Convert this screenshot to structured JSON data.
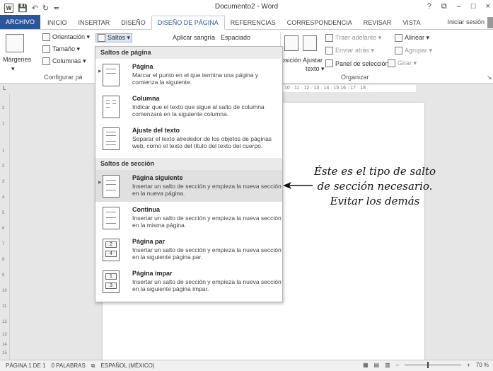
{
  "window": {
    "title": "Documento2 - Word",
    "help": "?",
    "restore_icon": "⧉",
    "minimize": "–",
    "close": "×",
    "word_icon": "W"
  },
  "qat": {
    "save": "💾",
    "undo": "↶",
    "redo": "↻",
    "more": "≖"
  },
  "tabs": [
    "ARCHIVO",
    "INICIO",
    "INSERTAR",
    "DISEÑO",
    "DISEÑO DE PÁGINA",
    "REFERENCIAS",
    "CORRESPONDENCIA",
    "REVISAR",
    "VISTA"
  ],
  "signin": "Iniciar sesión",
  "ribbon": {
    "margenes": "Márgenes",
    "orientacion": "Orientación ▾",
    "tamano": "Tamaño ▾",
    "columnas": "Columnas ▾",
    "saltos": "Saltos ▾",
    "aplicar_sangria": "Aplicar sangría",
    "espaciado": "Espaciado",
    "posicion": "osición",
    "ajustar": "Ajustar",
    "texto": "texto ▾",
    "traer_adelante": "Traer adelante ▾",
    "enviar_atras": "Enviar atrás ▾",
    "panel_seleccion": "Panel de selección",
    "alinear": "Alinear ▾",
    "agrupar": "Agrupar ▾",
    "girar": "Girar ▾",
    "grp_configurar": "Configurar pá",
    "grp_organizar": "Organizar"
  },
  "ruler": {
    "corner": "L",
    "marks": "10 · 11 · 12 · 13 · 14 · 15 16 · 17 · 18 ·",
    "vertical": [
      "2",
      "1",
      "1",
      "2",
      "3",
      "4",
      "5",
      "6",
      "7",
      "8",
      "9",
      "10",
      "11",
      "12",
      "13",
      "14",
      "15"
    ]
  },
  "dropdown": {
    "section_page": "Saltos de página",
    "section_section": "Saltos de sección",
    "items": [
      {
        "title": "Página",
        "desc": "Marcar el punto en el que termina una página y comienza la siguiente."
      },
      {
        "title": "Columna",
        "desc": "Indicar que el texto que sigue al salto de columna comenzará en la siguiente columna."
      },
      {
        "title": "Ajuste del texto",
        "desc": "Separar el texto alrededor de los objetos de páginas web, como el texto del título del texto del cuerpo."
      },
      {
        "title": "Página siguiente",
        "desc": "Insertar un salto de sección y empieza la nueva sección en la nueva página."
      },
      {
        "title": "Continua",
        "desc": "Insertar un salto de sección y empieza la nueva sección en la misma página."
      },
      {
        "title": "Página par",
        "desc": "Insertar un salto de sección y empieza la nueva sección en la siguiente página par."
      },
      {
        "title": "Página impar",
        "desc": "Insertar un salto de sección y empieza la nueva sección en la siguiente página impar."
      }
    ],
    "thumb_numbers": {
      "par_top": "2",
      "par_bottom": "4",
      "impar_top": "1",
      "impar_bottom": "3"
    }
  },
  "annotation": {
    "line1": "Éste es el tipo de salto",
    "line2": "de sección necesario.",
    "line3": "Evitar los demás"
  },
  "status": {
    "page": "PÁGINA 1 DE 1",
    "words": "0 PALABRAS",
    "lang": "ESPAÑOL (MÉXICO)",
    "zoom_minus": "–",
    "zoom_plus": "+",
    "zoom": "70 %",
    "zoom_level_percent": 70
  }
}
